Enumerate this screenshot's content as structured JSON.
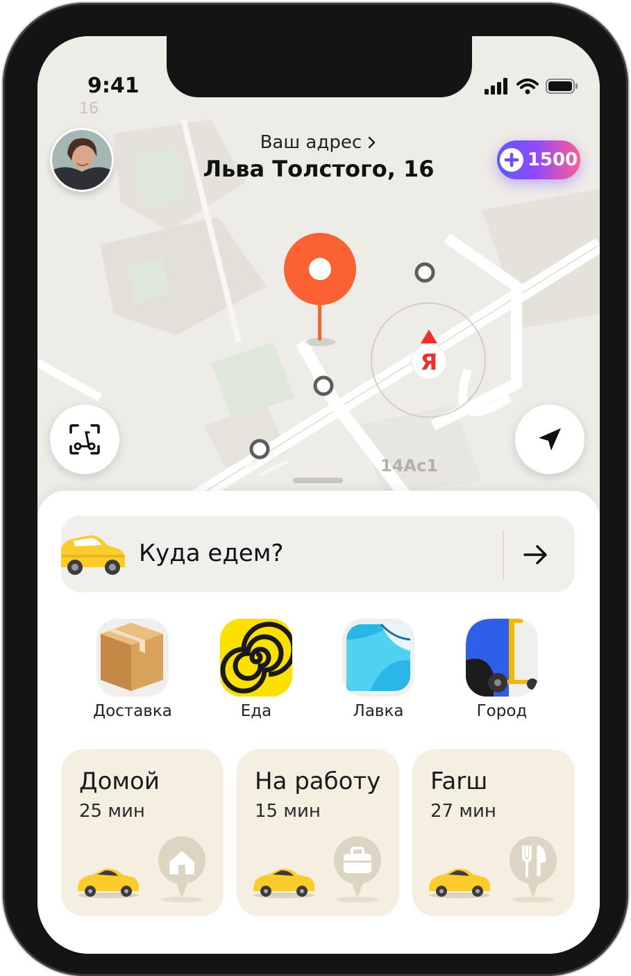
{
  "status_bar": {
    "time": "9:41"
  },
  "header": {
    "address_label": "Ваш адрес",
    "address_value": "Льва Толстого, 16"
  },
  "plus_badge": {
    "value": "1500"
  },
  "map": {
    "building_number_top": "16",
    "building_label": "14Ac1",
    "brand_marker": "Я"
  },
  "search": {
    "placeholder": "Куда едем?"
  },
  "services": [
    {
      "label": "Доставка",
      "icon": "delivery-box-icon"
    },
    {
      "label": "Еда",
      "icon": "food-spiral-icon"
    },
    {
      "label": "Лавка",
      "icon": "lavka-bag-icon"
    },
    {
      "label": "Город",
      "icon": "scooter-icon"
    }
  ],
  "shortcuts": [
    {
      "title": "Домой",
      "time": "25 мин",
      "icon": "home-icon"
    },
    {
      "title": "На работу",
      "time": "15 мин",
      "icon": "briefcase-icon"
    },
    {
      "title": "Farш",
      "time": "27 мин",
      "icon": "fork-knife-icon"
    }
  ],
  "colors": {
    "pin": "#fc6133",
    "taxi_yellow": "#fccc2d",
    "card_bg": "#f5efe1",
    "brand_red": "#f0302a"
  }
}
